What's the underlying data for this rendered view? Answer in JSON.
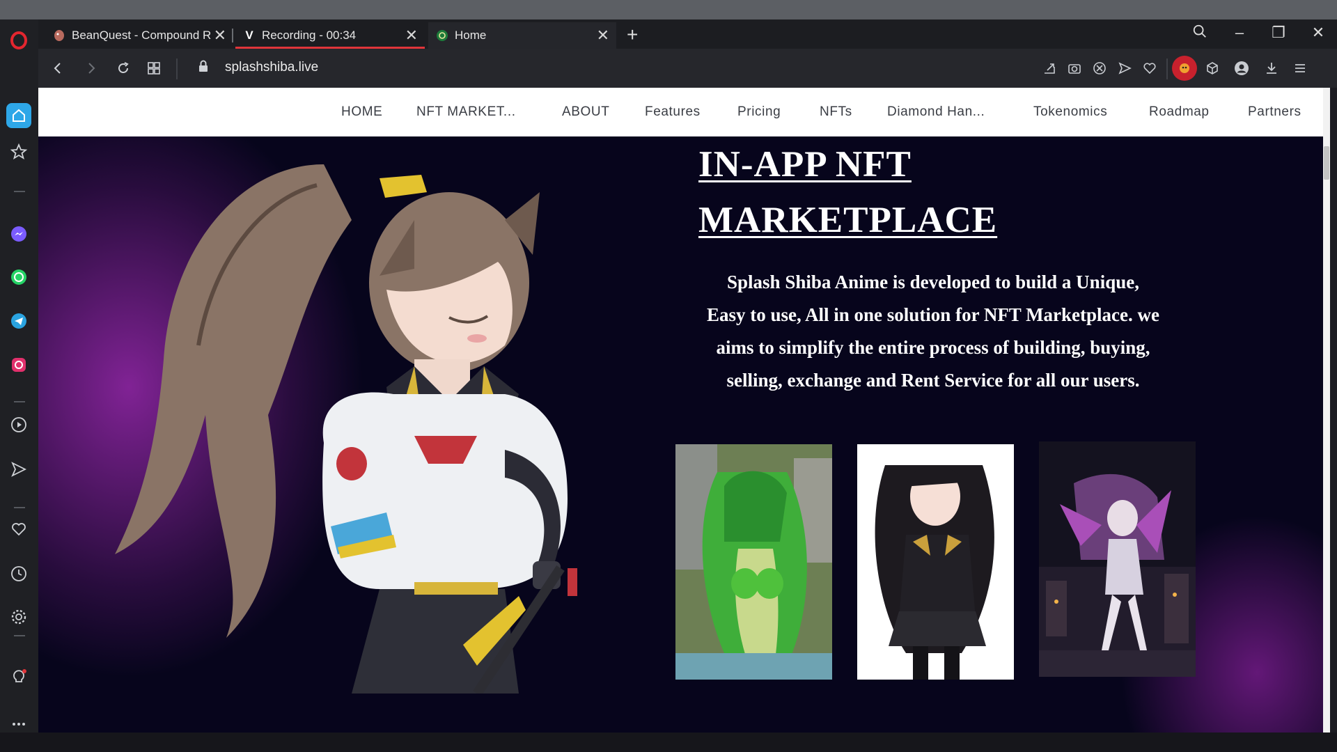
{
  "browser": {
    "tabs": [
      {
        "label": "BeanQuest - Compound R",
        "favicon": "bean-icon"
      },
      {
        "label": "Recording - 00:34",
        "favicon": "V"
      },
      {
        "label": "Home",
        "favicon": "green-circle-icon"
      }
    ],
    "url": "splashshiba.live"
  },
  "site": {
    "nav": [
      "HOME",
      "NFT MARKET...",
      "ABOUT",
      "Features",
      "Pricing",
      "NFTs",
      "Diamond Han...",
      "Tokenomics",
      "Roadmap",
      "Partners"
    ],
    "title_line1": "IN-APP NFT",
    "title_line2": "MARKETPLACE",
    "description": "Splash Shiba Anime is developed to build a Unique, Easy to use, All in one solution for NFT Marketplace. we aims to simplify the entire process of building, buying, selling, exchange and Rent Service for all our users."
  },
  "colors": {
    "accent_red": "#e0353a",
    "page_bg": "#07051c",
    "glow_purple": "#9628aa"
  }
}
